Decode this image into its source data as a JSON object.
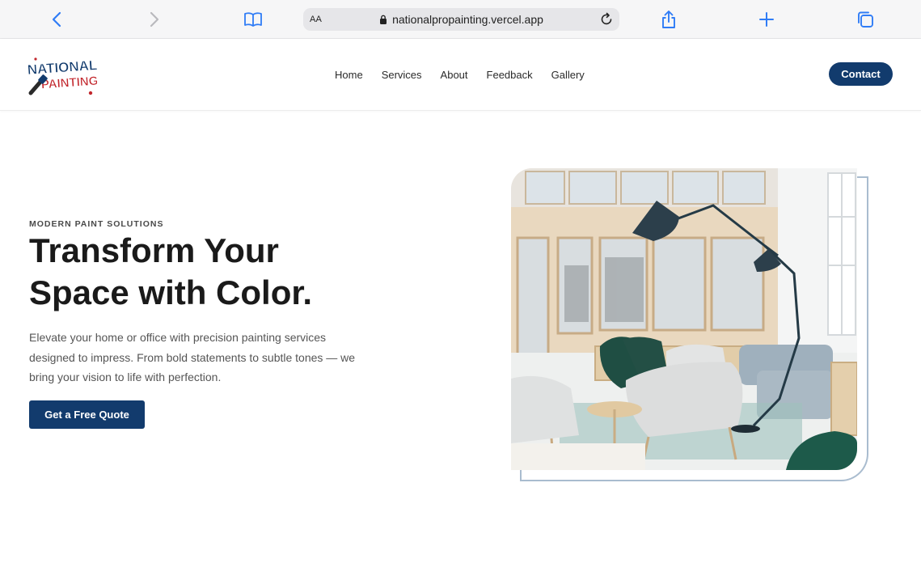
{
  "browser": {
    "url": "nationalpropainting.vercel.app",
    "text_size_label": "AA",
    "icons": [
      "back-icon",
      "forward-icon",
      "reader-icon",
      "lock-icon",
      "reload-icon",
      "share-icon",
      "new-tab-icon",
      "tabs-icon"
    ]
  },
  "header": {
    "logo": {
      "line1": "NATIONAL",
      "line2": "PAINTING",
      "icon": "paintbrush-icon"
    },
    "nav": [
      "Home",
      "Services",
      "About",
      "Feedback",
      "Gallery"
    ],
    "contact_label": "Contact"
  },
  "hero": {
    "eyebrow": "MODERN PAINT SOLUTIONS",
    "title_line1": "Transform Your",
    "title_line2": "Space with Color.",
    "description": "Elevate your home or office with precision painting services designed to impress. From bold statements to subtle tones — we bring your vision to life with perfection.",
    "cta_label": "Get a Free Quote",
    "image_subject": "bright-modern-office-interior"
  },
  "colors": {
    "brand_navy": "#123b6d",
    "brand_red": "#c2272d",
    "frame_outline": "#a9bccf",
    "browser_accent": "#2f7cf6"
  }
}
